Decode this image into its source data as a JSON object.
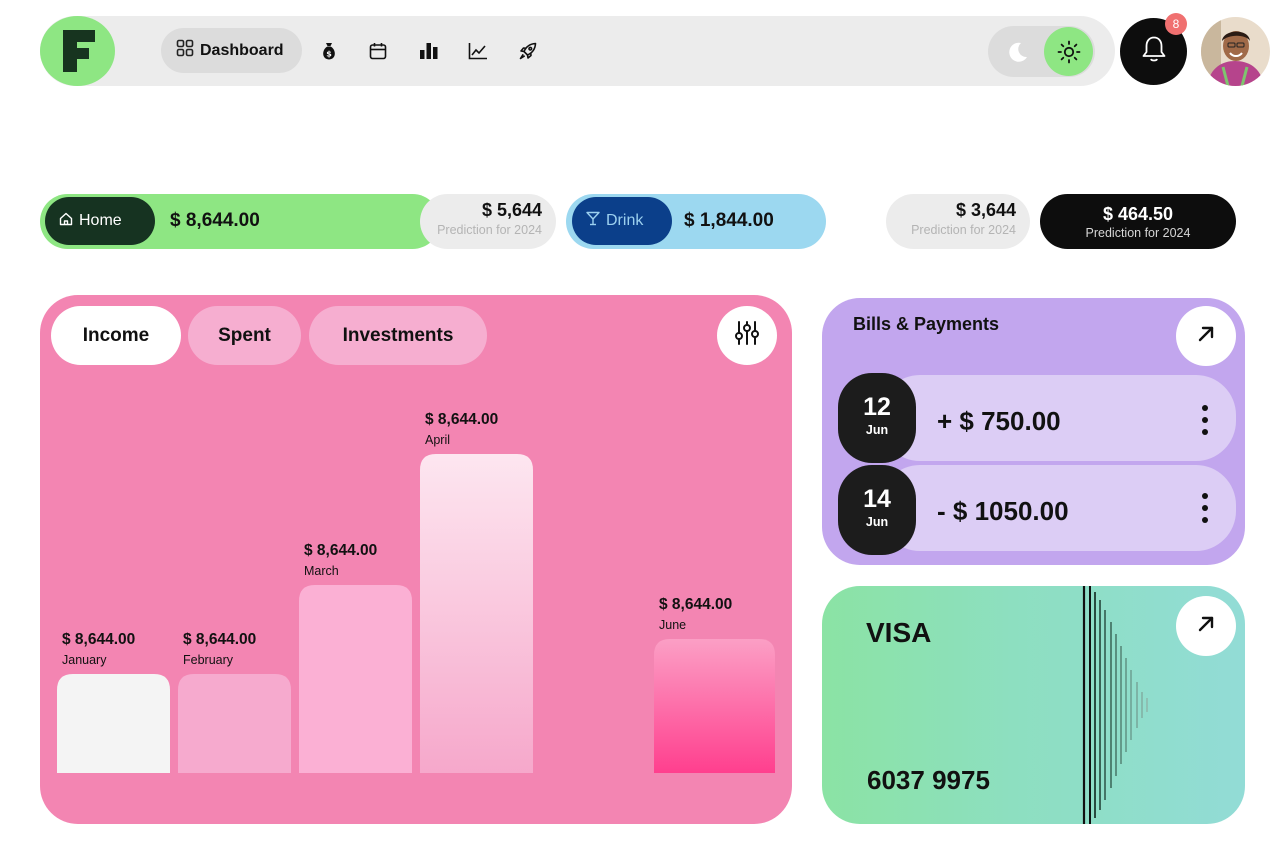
{
  "nav": {
    "dashboard_label": "Dashboard",
    "icons": [
      "money-bag-icon",
      "calendar-icon",
      "bar-chart-icon",
      "line-chart-icon",
      "rocket-icon"
    ],
    "notification_count": "8",
    "brand_color": "#8ee683"
  },
  "summary": {
    "home": {
      "label": "Home",
      "amount": "$ 8,644.00",
      "prediction_value": "$ 5,644",
      "prediction_label": "Prediction for 2024",
      "color": "#8ee683"
    },
    "drink": {
      "label": "Drink",
      "amount": "$ 1,844.00",
      "prediction_value": "$ 3,644",
      "prediction_label": "Prediction for 2024",
      "color": "#9cd8f0"
    },
    "total_prediction": {
      "value": "$ 464.50",
      "label": "Prediction for 2024"
    }
  },
  "chart_card": {
    "tabs": [
      {
        "label": "Income",
        "active": true
      },
      {
        "label": "Spent",
        "active": false
      },
      {
        "label": "Investments",
        "active": false
      }
    ],
    "card_color": "#f385b2"
  },
  "chart_data": {
    "type": "bar",
    "categories": [
      "January",
      "February",
      "March",
      "April",
      "June"
    ],
    "value_labels": [
      "$ 8,644.00",
      "$ 8,644.00",
      "$ 8,644.00",
      "$ 8,644.00",
      "$ 8,644.00"
    ],
    "relative_heights": [
      0.31,
      0.31,
      0.59,
      1.0,
      0.42
    ],
    "bar_colors": [
      "#f4f4f4",
      "#f6aace",
      "#fbb0d4",
      "#fde4ef",
      "#ff64a0"
    ]
  },
  "bills": {
    "title": "Bills & Payments",
    "payments": [
      {
        "day": "12",
        "month": "Jun",
        "amount": "+  $ 750.00"
      },
      {
        "day": "14",
        "month": "Jun",
        "amount": "-  $ 1050.00"
      }
    ]
  },
  "card": {
    "brand": "VISA",
    "number": "6037 9975"
  }
}
